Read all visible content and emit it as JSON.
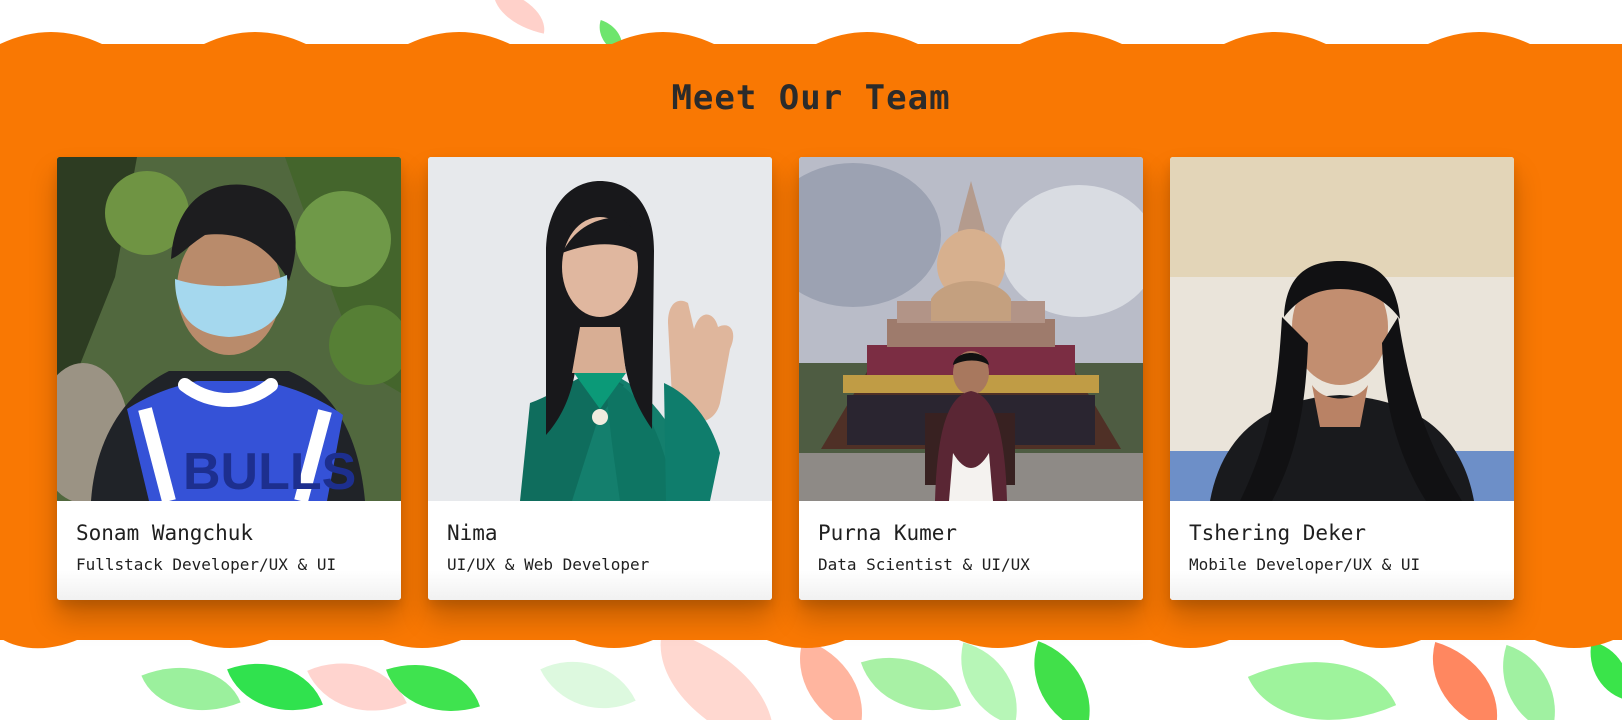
{
  "team": {
    "title": "Meet Our Team",
    "members": [
      {
        "name": "Sonam Wangchuk",
        "role": "Fullstack Developer/UX & UI",
        "photo_alt": "Sonam Wangchuk"
      },
      {
        "name": "Nima",
        "role": "UI/UX & Web Developer",
        "photo_alt": "Nima"
      },
      {
        "name": "Purna Kumer",
        "role": "Data Scientist & UI/UX",
        "photo_alt": "Purna Kumer"
      },
      {
        "name": "Tshering Deker",
        "role": "Mobile Developer/UX & UI",
        "photo_alt": "Tshering Deker"
      }
    ]
  },
  "theme": {
    "band_color": "#f97803",
    "card_color": "#ffffff",
    "text_color": "#202020",
    "leaf_green": "#3fe34f",
    "leaf_light_green": "#9ef39c",
    "leaf_coral": "#ff8760",
    "leaf_pink": "#ffd8d0"
  }
}
